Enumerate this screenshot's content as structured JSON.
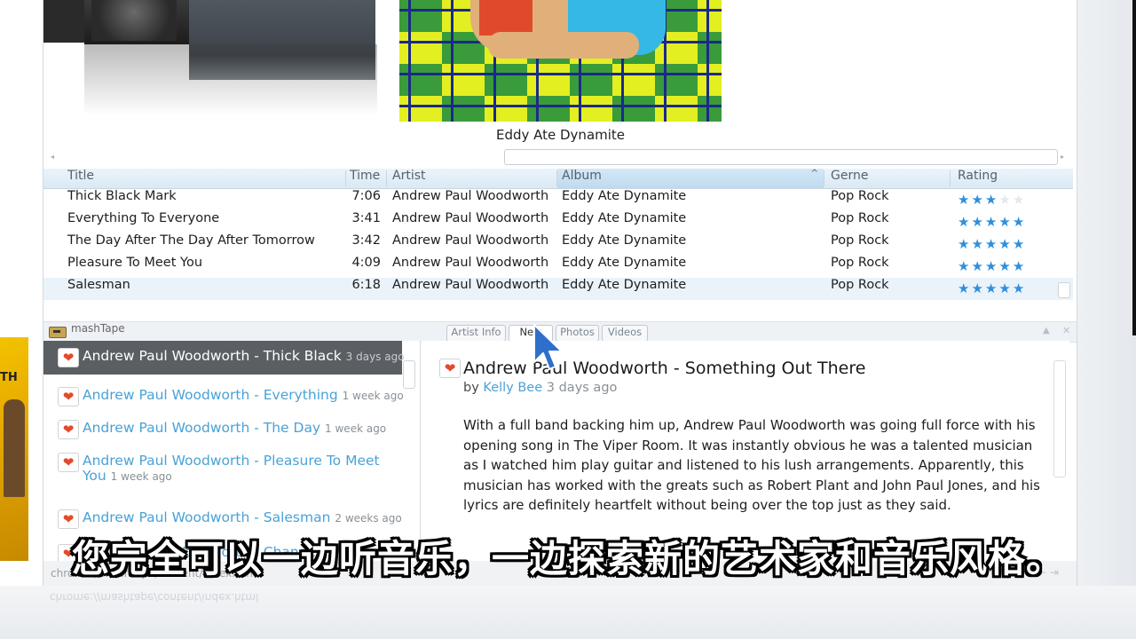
{
  "cover_flow": {
    "caption": "Eddy Ate Dynamite"
  },
  "table": {
    "headers": {
      "title": "Title",
      "time": "Time",
      "artist": "Artist",
      "album": "Album",
      "genre": "Gerne",
      "rating": "Rating"
    },
    "sort_indicator": "^",
    "rows": [
      {
        "title": "Thick Black Mark",
        "time": "7:06",
        "artist": "Andrew Paul Woodworth",
        "album": "Eddy Ate Dynamite",
        "genre": "Pop Rock",
        "rating": 3
      },
      {
        "title": "Everything To Everyone",
        "time": "3:41",
        "artist": "Andrew Paul Woodworth",
        "album": "Eddy Ate Dynamite",
        "genre": "Pop Rock",
        "rating": 5
      },
      {
        "title": "The Day After The Day After Tomorrow",
        "time": "3:42",
        "artist": "Andrew Paul Woodworth",
        "album": "Eddy Ate Dynamite",
        "genre": "Pop Rock",
        "rating": 5
      },
      {
        "title": "Pleasure To Meet You",
        "time": "4:09",
        "artist": "Andrew Paul Woodworth",
        "album": "Eddy Ate Dynamite",
        "genre": "Pop Rock",
        "rating": 5
      },
      {
        "title": "Salesman",
        "time": "6:18",
        "artist": "Andrew Paul Woodworth",
        "album": "Eddy Ate Dynamite",
        "genre": "Pop Rock",
        "rating": 5
      }
    ]
  },
  "mashtape": {
    "title": "mashTape",
    "tabs": [
      "Artist Info",
      "New",
      "Photos",
      "Videos"
    ],
    "news": [
      {
        "title": "Andrew Paul Woodworth - Thick Black",
        "age": "3 days ago"
      },
      {
        "title": "Andrew Paul Woodworth - Everything",
        "age": "1 week ago"
      },
      {
        "title": "Andrew Paul Woodworth - The Day",
        "age": "1 week ago"
      },
      {
        "title": "Andrew Paul Woodworth - Pleasure To Meet You",
        "age": "1 week ago"
      },
      {
        "title": "Andrew Paul Woodworth - Salesman",
        "age": "2 weeks ago"
      },
      {
        "title": "Andrew Paul Woodworth - Change",
        "age": ""
      }
    ],
    "article": {
      "title": "Andrew Paul Woodworth - Something Out There",
      "by": "by",
      "author": "Kelly Bee",
      "age": "3 days ago",
      "body": "With a full band backing him up, Andrew Paul Woodworth was going full force with his opening song in The Viper Room. It was instantly obvious he was a talented musician as I watched him play guitar and listened to his lush arrangements. Apparently, this musician has worked with the greats such as Robert Plant and John Paul Jones, and his lyrics are definitely heartfelt without being over the top just as they said."
    }
  },
  "status": {
    "url": "chrome://mashtape/content/index.html"
  },
  "left_peek_text": "TH",
  "subtitle": "您完全可以一边听音乐，一边探索新的艺术家和音乐风格。",
  "colors": {
    "accent": "#4aa2d6",
    "star": "#2f8fdc",
    "selected_news": "#5b5f63"
  },
  "icons": [
    "heart-icon",
    "mouse-cursor-icon",
    "cassette-icon",
    "sort-ascending-icon",
    "star-icon"
  ]
}
